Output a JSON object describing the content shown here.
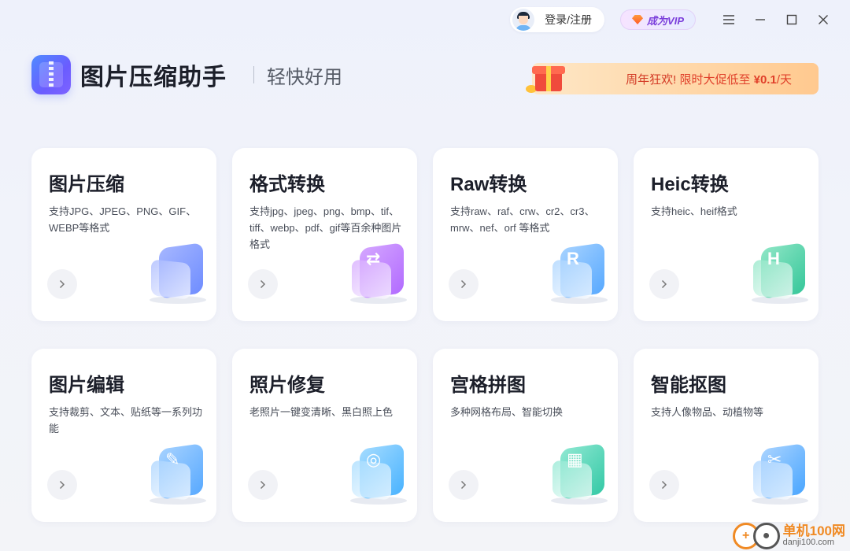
{
  "topbar": {
    "login_label": "登录/注册",
    "vip_label": "成为VIP"
  },
  "header": {
    "app_title": "图片压缩助手",
    "slogan": "轻快好用",
    "promo_prefix": "周年狂欢!",
    "promo_middle": "限时大促低至",
    "promo_price": "¥0.1",
    "promo_suffix": "/天"
  },
  "cards": [
    {
      "title": "图片压缩",
      "desc": "支持JPG、JPEG、PNG、GIF、WEBP等格式",
      "icon": "zip-file-icon",
      "color_a": "#6f8dff",
      "color_b": "#a5b6ff",
      "mark": ""
    },
    {
      "title": "格式转换",
      "desc": "支持jpg、jpeg、png、bmp、tif、tiff、webp、pdf、gif等百余种图片格式",
      "icon": "format-convert-icon",
      "color_a": "#b26bff",
      "color_b": "#d4a6ff",
      "mark": "⇄"
    },
    {
      "title": "Raw转换",
      "desc": "支持raw、raf、crw、cr2、cr3、mrw、nef、orf 等格式",
      "icon": "raw-convert-icon",
      "color_a": "#58a9ff",
      "color_b": "#a6d2ff",
      "mark": "R"
    },
    {
      "title": "Heic转换",
      "desc": "支持heic、heif格式",
      "icon": "heic-convert-icon",
      "color_a": "#36c79a",
      "color_b": "#8fe6c6",
      "mark": "H"
    },
    {
      "title": "图片编辑",
      "desc": "支持裁剪、文本、贴纸等一系列功能",
      "icon": "image-edit-icon",
      "color_a": "#58a9ff",
      "color_b": "#a6d2ff",
      "mark": "✎"
    },
    {
      "title": "照片修复",
      "desc": "老照片一键变清晰、黑白照上色",
      "icon": "photo-repair-icon",
      "color_a": "#4ab3ff",
      "color_b": "#a3dbff",
      "mark": "◎"
    },
    {
      "title": "宫格拼图",
      "desc": "多种网格布局、智能切换",
      "icon": "grid-collage-icon",
      "color_a": "#34c9a6",
      "color_b": "#8fe8d2",
      "mark": "▦"
    },
    {
      "title": "智能抠图",
      "desc": "支持人像物品、动植物等",
      "icon": "smart-cutout-icon",
      "color_a": "#4aa6ff",
      "color_b": "#a9d3ff",
      "mark": "✂"
    }
  ],
  "watermark": {
    "name": "单机100网",
    "url": "danji100.com"
  }
}
